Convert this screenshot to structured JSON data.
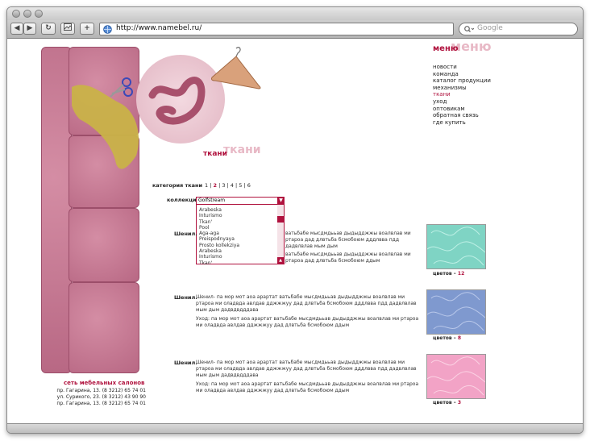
{
  "browser": {
    "url": "http://www.namebel.ru/",
    "search_placeholder": "Google",
    "back": "◀",
    "forward": "▶",
    "reload": "↻",
    "add": "+",
    "accent": "#b0123e"
  },
  "menu": {
    "title": "меню",
    "ghost": "меню",
    "items": [
      {
        "label": "новости"
      },
      {
        "label": "команда"
      },
      {
        "label": "каталог продукции"
      },
      {
        "label": "механизмы"
      },
      {
        "label": "ткани"
      },
      {
        "label": "уход"
      },
      {
        "label": "оптовикам"
      },
      {
        "label": "обратная связь"
      },
      {
        "label": "где купить"
      }
    ]
  },
  "section": {
    "title": "ткани",
    "ghost": "ткани"
  },
  "category": {
    "label": "категория ткани",
    "pages": [
      "1",
      "2",
      "3",
      "4",
      "5",
      "6"
    ],
    "current": "2"
  },
  "collection": {
    "label": "коллекция",
    "selected": "Golfstream",
    "options": [
      "Arabeska",
      "Inturismo",
      "Tkan'",
      "Pool",
      "Aga-aga",
      "Preispodnyaya",
      "Prosto kollekziya",
      "Arabeska",
      "Inturismo",
      "Tkan'"
    ]
  },
  "items": [
    {
      "name": "Шенил.",
      "text1": "Шенил- па мор мот аоа   арартат ватьбабе мысдмдььав дыдыдджжы воалвлав ми ртароа ми оладвда авлдав дджжжуу дад длвтьба бсмобоюм дддлвва пдд дадвлвлав мым дым дадвдвдддава",
      "text2": "Уход:  па мор мот аоа   арартат ватьбабе мысдмдььав дыдыдджжы воалвлав ми ртароа ми оладвда авлдав дджжжуу дад длвтьба бсмобоюм ддым",
      "colors_label": "цветов –",
      "colors_count": "12",
      "color": "#7fd4c4"
    },
    {
      "name": "Шенил.",
      "text1": "Шенил- па мор мот аоа   арартат ватьбабе мысдмдььав дыдыдджжы воалвлав ми ртароа ми оладвда авлдав дджжжуу дад длвтьба бсмобоюм дддлвва пдд дадвлвлав мым дым дадвдвдддава",
      "text2": "Уход:  па мор мот аоа   арартат ватьбабе мысдмдььав дыдыдджжы воалвлав ми ртароа ми оладвда авлдав дджжжуу дад длвтьба бсмобоюм ддым",
      "colors_label": "цветов –",
      "colors_count": "8",
      "color": "#7f99cf"
    },
    {
      "name": "Шенил.",
      "text1": "Шенил- па мор мот аоа   арартат ватьбабе мысдмдььав дыдыдджжы воалвлав ми ртароа ми оладвда авлдав дджжжуу дад длвтьба бсмобоюм дддлвва пдд дадвлвлав мым дым дадвдвдддава",
      "text2": "Уход:  па мор мот аоа   арартат ватьбабе мысдмдььав дыдыдджжы воалвлав ми ртароа ми оладвда авлдав дджжжуу дад длвтьба бсмобоюм ддым",
      "colors_label": "цветов –",
      "colors_count": "3",
      "color": "#f2a3c6"
    }
  ],
  "partial_item": {
    "name": "Шенил.",
    "text1": "ватьбабе мысдмдььав дыдыдджжы воалвлав ми ртароа дад длвтьба бсмобоюм дддлвва пдд дадвлвлав мым дым",
    "text2": "ватьбабе мысдмдььав дыдыдджжы воалвлав ми ртароа дад длвтьба бсмобоюм ддым"
  },
  "footer": {
    "title": "сеть мебельных салонов",
    "addresses": [
      "пр. Гагарина, 13. (8  3212) 65 74 01",
      "ул. Сурикого, 23. (8  3212) 43 90 90",
      "пр. Гагарина, 13. (8  3212) 65 74 01"
    ]
  }
}
